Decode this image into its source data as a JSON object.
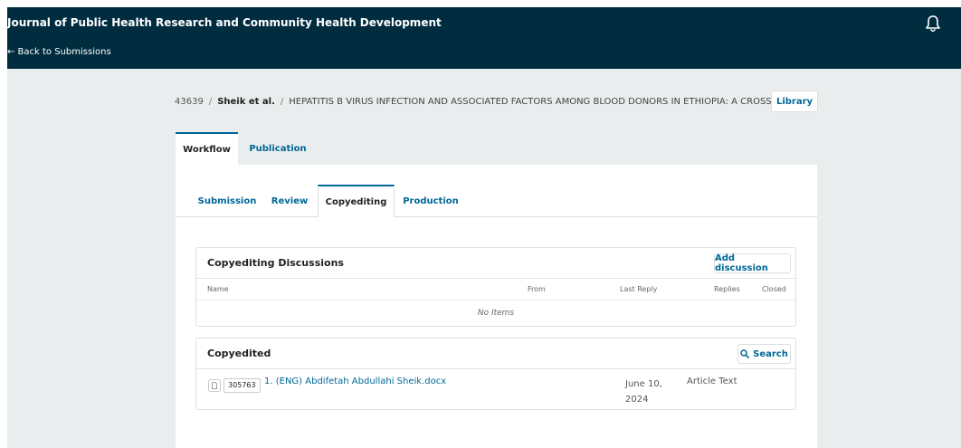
{
  "header": {
    "journal_title": "Journal of Public Health Research and Community Health Development",
    "back_label": "← Back to Submissions",
    "notifications_icon": "bell-icon"
  },
  "breadcrumb": {
    "id": "43639",
    "separator": "/",
    "author": "Sheik et al.",
    "title": "HEPATITIS B VIRUS INFECTION AND ASSOCIATED FACTORS AMONG BLOOD DONORS IN ETHIOPIA: A CROSS-SECTIONAL STUDY",
    "library_label": "Library"
  },
  "main_tabs": [
    {
      "label": "Workflow",
      "active": true
    },
    {
      "label": "Publication",
      "active": false
    }
  ],
  "stage_tabs": [
    {
      "label": "Submission",
      "active": false
    },
    {
      "label": "Review",
      "active": false
    },
    {
      "label": "Copyediting",
      "active": true
    },
    {
      "label": "Production",
      "active": false
    }
  ],
  "discussions": {
    "title": "Copyediting Discussions",
    "add_label": "Add discussion",
    "columns": [
      "Name",
      "From",
      "Last Reply",
      "Replies",
      "Closed"
    ],
    "empty_text": "No Items"
  },
  "copyedited": {
    "title": "Copyedited",
    "search_label": "Search",
    "files": [
      {
        "id": "305763",
        "name": "1. (ENG) Abdifetah Abdullahi Sheik.docx",
        "date_line1": "June 10,",
        "date_line2": "2024",
        "type": "Article Text"
      }
    ]
  },
  "colors": {
    "header_bg": "#002c40",
    "link": "#006798",
    "page_bg": "#eaedee"
  }
}
